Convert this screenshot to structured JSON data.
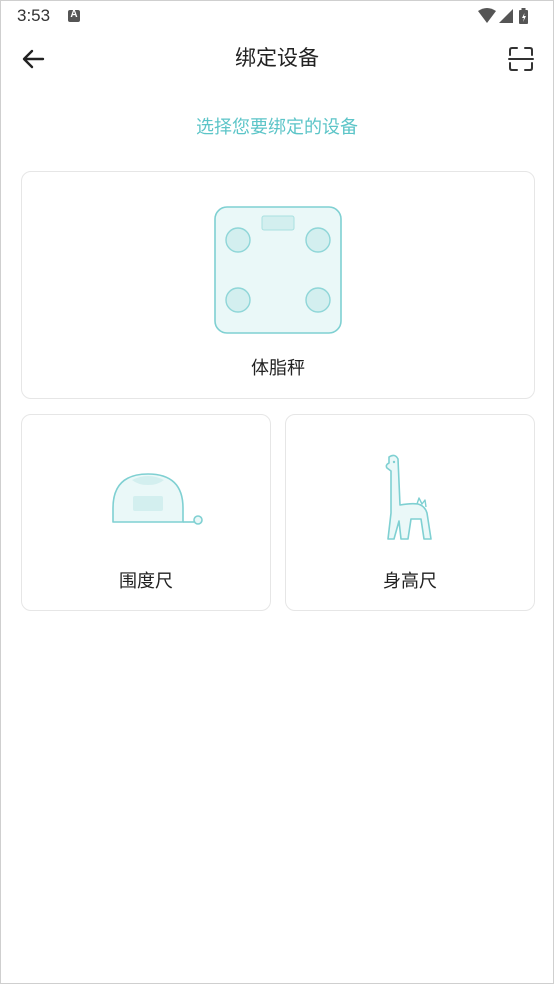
{
  "status_bar": {
    "time": "3:53",
    "notification_icon": "a-icon",
    "icons": [
      "wifi-icon",
      "signal-icon",
      "battery-icon"
    ]
  },
  "app_bar": {
    "title": "绑定设备",
    "back_icon": "back-arrow-icon",
    "scan_icon": "scan-icon"
  },
  "hint": "选择您要绑定的设备",
  "devices": [
    {
      "label": "体脂秤",
      "icon": "body-fat-scale-icon"
    },
    {
      "label": "围度尺",
      "icon": "tape-measure-icon"
    },
    {
      "label": "身高尺",
      "icon": "giraffe-height-ruler-icon"
    }
  ],
  "colors": {
    "accent": "#5dc5c8",
    "icon_fill": "#eaf8f8",
    "icon_inner": "#d3efef",
    "card_border": "#e6e6e6"
  }
}
